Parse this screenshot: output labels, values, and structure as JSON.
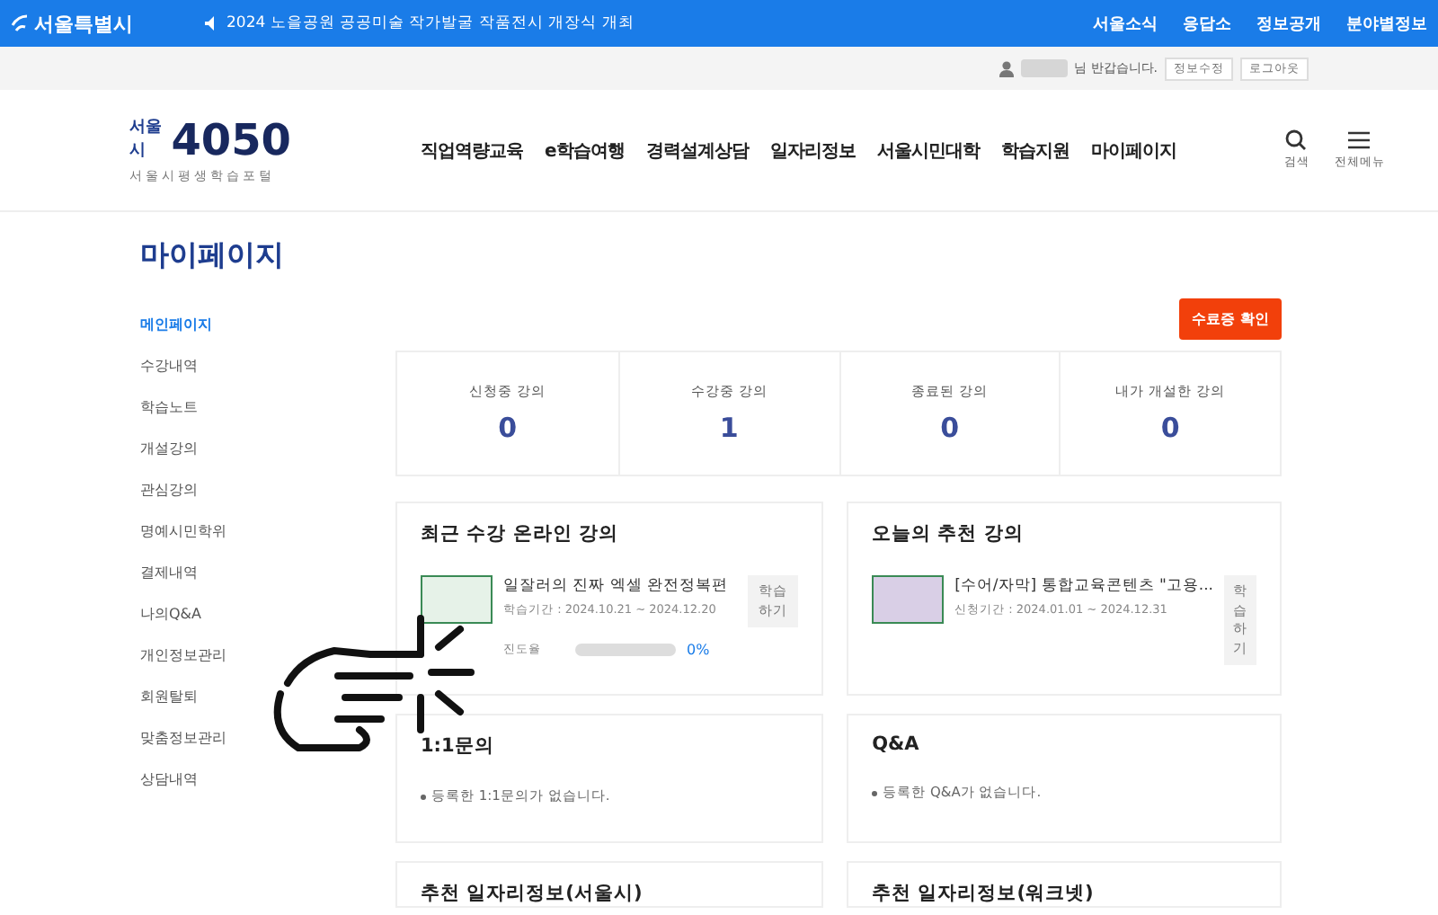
{
  "topbar": {
    "brand": "서울특별시",
    "notice": "2024 노을공원 공공미술 작가발굴 작품전시 개장식 개최",
    "links": [
      "서울소식",
      "응답소",
      "정보공개",
      "분야별정보"
    ]
  },
  "userbar": {
    "greeting": "님 반갑습니다.",
    "buttons": [
      "정보수정",
      "로그아웃"
    ]
  },
  "header": {
    "logo": {
      "small": "서울시",
      "big": "4050",
      "sub": "서울시평생학습포털"
    },
    "nav": [
      "직업역량교육",
      "e학습여행",
      "경력설계상담",
      "일자리정보",
      "서울시민대학",
      "학습지원",
      "마이페이지"
    ],
    "tools": [
      {
        "kind": "search",
        "label": "검색"
      },
      {
        "kind": "menu",
        "label": "전체메뉴"
      }
    ]
  },
  "page_title": "마이페이지",
  "sidebar": {
    "items": [
      {
        "label": "메인페이지",
        "selected": true
      },
      {
        "label": "수강내역",
        "selected": false
      },
      {
        "label": "학습노트",
        "selected": false
      },
      {
        "label": "개설강의",
        "selected": false
      },
      {
        "label": "관심강의",
        "selected": false
      },
      {
        "label": "명예시민학위",
        "selected": false
      },
      {
        "label": "결제내역",
        "selected": false
      },
      {
        "label": "나의Q&A",
        "selected": false
      },
      {
        "label": "개인정보관리",
        "selected": false
      },
      {
        "label": "회원탈퇴",
        "selected": false
      },
      {
        "label": "맞춤정보관리",
        "selected": false
      },
      {
        "label": "상담내역",
        "selected": false
      }
    ]
  },
  "completion_button": "수료증 확인",
  "stats": [
    {
      "label": "신청중 강의",
      "value": "0"
    },
    {
      "label": "수강중 강의",
      "value": "1"
    },
    {
      "label": "종료된 강의",
      "value": "0"
    },
    {
      "label": "내가 개설한 강의",
      "value": "0"
    }
  ],
  "recent_courses": {
    "title": "최근 수강 온라인 강의",
    "items": [
      {
        "title": "일잘러의 진짜 엑셀 완전정복편",
        "period": "학습기간 : 2024.10.21 ~ 2024.12.20",
        "progress_label": "진도율",
        "level": 0,
        "reading": "0%",
        "button": "학습하기"
      }
    ]
  },
  "recommended": {
    "title": "오늘의 추천 강의",
    "items": [
      {
        "title": "[수어/자막] 통합교육콘텐츠 \"고용...",
        "period": "신청기간 : 2024.01.01 ~ 2024.12.31",
        "button": "학습하기"
      }
    ]
  },
  "inquiry": {
    "title": "1:1문의",
    "empty": "등록한 1:1문의가 없습니다."
  },
  "qna": {
    "title": "Q&A",
    "empty": "등록한 Q&A가 없습니다."
  },
  "bottom_cards": [
    "추천 일자리정보(서울시)",
    "추천 일자리정보(워크넷)"
  ]
}
